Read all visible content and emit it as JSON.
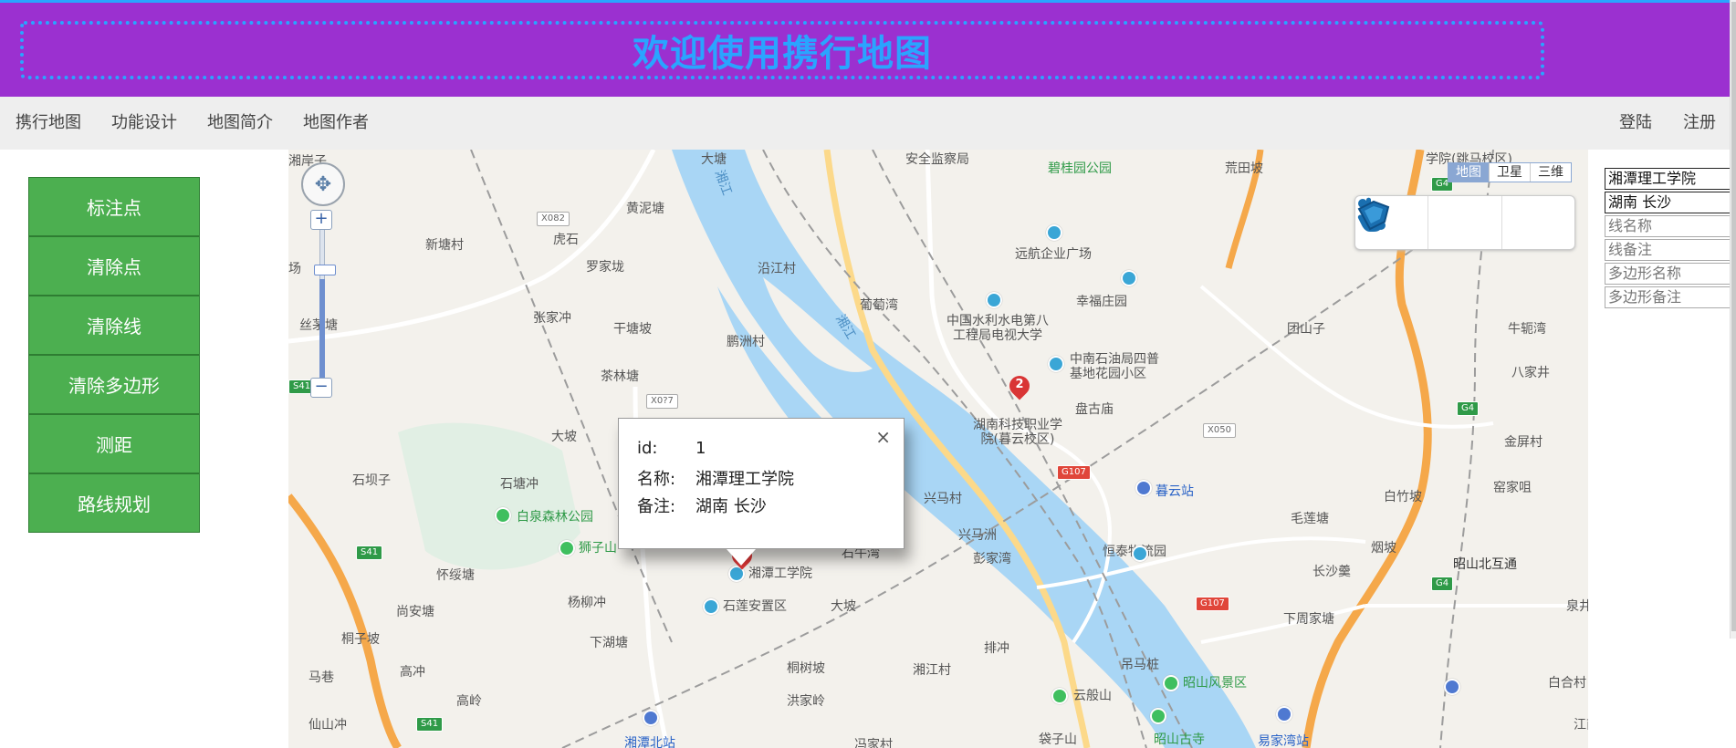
{
  "header": {
    "title": "欢迎使用携行地图"
  },
  "nav": {
    "left": [
      "携行地图",
      "功能设计",
      "地图简介",
      "地图作者"
    ],
    "right": [
      "登陆",
      "注册"
    ]
  },
  "sidebar": {
    "buttons": [
      "标注点",
      "清除点",
      "清除线",
      "清除多边形",
      "测距",
      "路线规划"
    ]
  },
  "map": {
    "map_types": [
      "地图",
      "卫星",
      "三维"
    ],
    "active_map_type": "地图",
    "draw_tools": [
      {
        "icon": "hand-pointer-icon"
      },
      {
        "icon": "polyline-icon"
      },
      {
        "icon": "polygon-icon"
      }
    ],
    "zoom": {
      "plus": "+",
      "minus": "−"
    },
    "water_labels": [
      "湘江",
      "湘江",
      "湘江"
    ],
    "place_labels": [
      "湘岸子",
      "大塘",
      "安全监察局",
      "碧桂园公园",
      "荒田坡",
      "学院(跳马校区)",
      "黄泥塘",
      "新塘村",
      "虎石",
      "罗家垅",
      "沿江村",
      "远航企业广场",
      "幸福庄园",
      "场",
      "丝茅塘",
      "张家冲",
      "干塘坡",
      "葡萄湾",
      "鹏洲村",
      "中国水利水电第八工程局电视大学",
      "中南石油局四普基地花园小区",
      "团山子",
      "牛轭湾",
      "八家井",
      "茶林塘",
      "盘古庙",
      "湖南科技职业学院(暮云校区)",
      "金屏村",
      "大坡",
      "石坝子",
      "石塘冲",
      "兴马村",
      "暮云站",
      "白竹坡",
      "窑家咀",
      "白泉森林公园",
      "狮子山",
      "石牛湾",
      "兴马洲",
      "恒泰物流园",
      "毛莲塘",
      "怀绥塘",
      "彭家湾",
      "烟坡",
      "杨柳冲",
      "湘潭工学院",
      "长沙羹",
      "昭山北互通",
      "尚安塘",
      "石莲安置区",
      "大坡",
      "下周家塘",
      "桐子坡",
      "下湖塘",
      "排冲",
      "泉井",
      "马巷",
      "高冲",
      "桐树坡",
      "湘江村",
      "吊马桩",
      "昭山风景区",
      "白合村",
      "高岭",
      "洪家岭",
      "云般山",
      "仙山冲",
      "湘潭北站",
      "冯家村",
      "袋子山",
      "昭山古寺",
      "易家湾站",
      "江南"
    ],
    "road_shields": [
      "X082",
      "S41",
      "X0?7",
      "S41",
      "S41",
      "G107",
      "G107",
      "X050",
      "G4",
      "G4",
      "G4"
    ],
    "markers": [
      {
        "number": "1"
      },
      {
        "number": "2"
      }
    ],
    "popup": {
      "close": "×",
      "rows": [
        {
          "key": "id:",
          "value": "1"
        },
        {
          "key": "名称:",
          "value": "湘潭理工学院"
        },
        {
          "key": "备注:",
          "value": "湖南 长沙"
        }
      ]
    }
  },
  "right_panel": {
    "fields": [
      {
        "value": "湘潭理工学院",
        "placeholder": ""
      },
      {
        "value": "湖南 长沙",
        "placeholder": ""
      },
      {
        "value": "",
        "placeholder": "线名称"
      },
      {
        "value": "",
        "placeholder": "线备注"
      },
      {
        "value": "",
        "placeholder": "多边形名称"
      },
      {
        "value": "",
        "placeholder": "多边形备注"
      }
    ]
  },
  "colors": {
    "header_bg": "#9b30d0",
    "header_accent": "#2aa4ff",
    "sidebar_button": "#4caf50",
    "river": "#a9d6f5",
    "marker": "#d93535"
  }
}
